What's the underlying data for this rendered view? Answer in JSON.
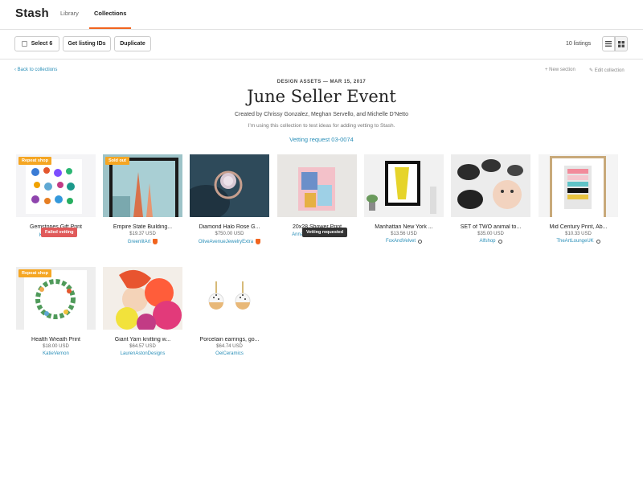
{
  "nav": {
    "brand": "Stash",
    "tabs": [
      "Library",
      "Collections"
    ]
  },
  "toolbar": {
    "select_label": "Select 6",
    "get_ids_label": "Get listing IDs",
    "duplicate_label": "Duplicate",
    "listing_count": "10 listings"
  },
  "header": {
    "back_label": "Back to collections",
    "new_section_label": "New section",
    "edit_collection_label": "Edit collection",
    "eyebrow": "DESIGN ASSETS — MAR 15, 2017",
    "title": "June Seller Event",
    "creators": "Created by Chrissy Gonzalez, Meghan Servello, and Michelle D’Netto",
    "description": "I’m using this collection to test ideas for adding vetting to Stash.",
    "vetting_request": "Vetting request 03-0074"
  },
  "tooltips": {
    "failed": "Failed vetting",
    "requested": "Vetting requested"
  },
  "listings": [
    {
      "name": "Gemstones Gift Print",
      "price": "",
      "shop": "KatieVernon",
      "badge": "Repeat shop",
      "status": "failed"
    },
    {
      "name": "Empire State Building...",
      "price": "$19.37 USD",
      "shop": "GreenlitArt",
      "badge": "Sold out",
      "status": "shield"
    },
    {
      "name": "Diamond Halo Rose G...",
      "price": "$750.00 USD",
      "shop": "OliveAvenueJewelryExtra",
      "badge": "",
      "status": "shield"
    },
    {
      "name": "20x28 Shower Print",
      "price": "",
      "shop": "AnnaSpurlingDesign",
      "badge": "",
      "status": "requested"
    },
    {
      "name": "Manhattan New York ...",
      "price": "$13.56 USD",
      "shop": "FoxAndVelvet",
      "badge": "",
      "status": "clock"
    },
    {
      "name": "SET of TWO animal to...",
      "price": "$35.00 USD",
      "shop": "Alfshop",
      "badge": "",
      "status": "clock"
    },
    {
      "name": "Mid Century Print, Ab...",
      "price": "$10.33 USD",
      "shop": "TheArtLoungeUK",
      "badge": "",
      "status": "clock"
    },
    {
      "name": "Health Wreath Print",
      "price": "$18.00 USD",
      "shop": "KatieVernon",
      "badge": "Repeat shop",
      "status": ""
    },
    {
      "name": "Giant Yarn knitting w...",
      "price": "$64.57 USD",
      "shop": "LaurenAstonDesigns",
      "badge": "",
      "status": ""
    },
    {
      "name": "Porcelain earrings, go...",
      "price": "$64.74 USD",
      "shop": "OeiCeramics",
      "badge": "",
      "status": ""
    }
  ],
  "colors": {
    "accent": "#f1641e",
    "link": "#2a8fb8",
    "badge": "#f5a623",
    "fail": "#e05a5a"
  }
}
